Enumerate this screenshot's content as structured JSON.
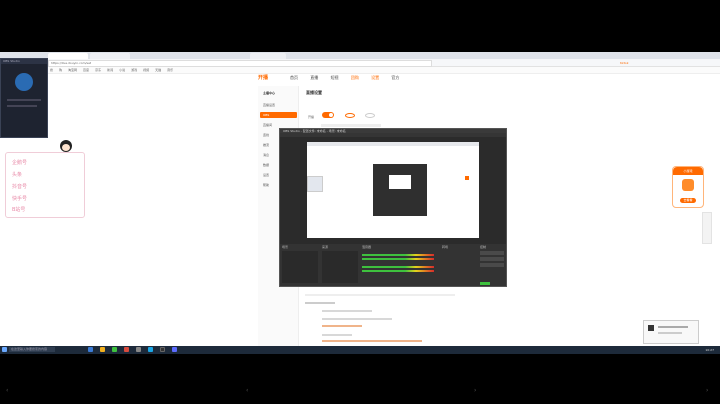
{
  "browser": {
    "title": "tiktok",
    "url": "https://live.douyin.com/set",
    "bookmarks": [
      "搜",
      "购",
      "淘宝网",
      "百度",
      "京东",
      "新闻",
      "小说",
      "游戏",
      "视频",
      "天猫",
      "音乐"
    ]
  },
  "site": {
    "logo": "开播",
    "nav": [
      "首页",
      "直播",
      "短视",
      "团购",
      "设置",
      "官方"
    ],
    "sidebar": [
      "主播中心",
      "直播设置",
      "OBS",
      "直播间",
      "连线",
      "推流",
      "消息",
      "数据",
      "设置",
      "帮助"
    ],
    "section_title": "直播设置",
    "toggle_label": "开播"
  },
  "obs": {
    "title": "OBS Studio - 配置文件: 未命名 - 场景: 未命名",
    "dock_labels": [
      "场景",
      "来源",
      "混音器",
      "转场",
      "控制"
    ]
  },
  "widget": {
    "rows": [
      "企鹅号",
      "头条",
      "抖音号",
      "快手号",
      "B站号"
    ]
  },
  "qr_window": {
    "title": "OBS Studio"
  },
  "right_card": {
    "head": "小游戏",
    "button": "去看看"
  },
  "taskbar": {
    "search_placeholder": "在这里输入你要搜索的内容",
    "clock": "10:27"
  },
  "colors": {
    "brand": "#ff6a00",
    "taskbar": "#1d2a3a",
    "obs_bg": "#2b2b2b"
  }
}
